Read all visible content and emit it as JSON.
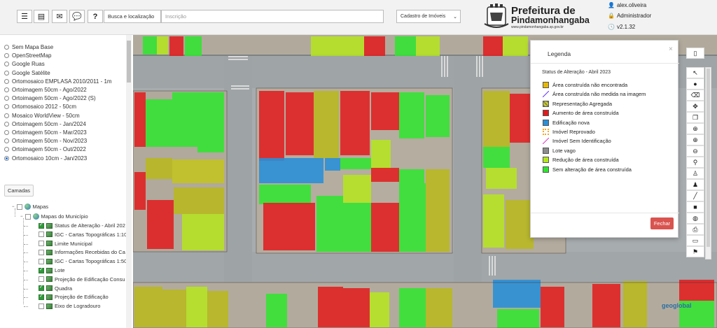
{
  "header": {
    "search_label": "Busca e localização",
    "search_placeholder": "Inscrição",
    "layer_select": "Cadastro de Imóveis",
    "brand_line1": "Prefeitura de",
    "brand_line2": "Pindamonhangaba",
    "brand_line3": "www.pindamonhangaba.sp.gov.br",
    "user": "alex.oliveira",
    "role": "Administrador",
    "version": "v2.1.32"
  },
  "basemaps": [
    {
      "label": "Sem Mapa Base",
      "selected": false
    },
    {
      "label": "OpenStreetMap",
      "selected": false
    },
    {
      "label": "Google Ruas",
      "selected": false
    },
    {
      "label": "Google Satélite",
      "selected": false
    },
    {
      "label": "Ortomosaico EMPLASA 2010/2011 - 1m",
      "selected": false
    },
    {
      "label": "Ortoimagem 50cm - Ago/2022",
      "selected": false
    },
    {
      "label": "Ortoimagem 50cm - Ago/2022 (S)",
      "selected": false
    },
    {
      "label": "Ortomosaico 2012 - 50cm",
      "selected": false
    },
    {
      "label": "Mosaico WorldView - 50cm",
      "selected": false
    },
    {
      "label": "Ortoimagem 50cm - Jan/2024",
      "selected": false
    },
    {
      "label": "Ortoimagem 50cm - Mar/2023",
      "selected": false
    },
    {
      "label": "Ortoimagem 50cm - Nov/2023",
      "selected": false
    },
    {
      "label": "Ortoimagem 50cm - Out/2022",
      "selected": false
    },
    {
      "label": "Ortomosaico 10cm - Jan/2023",
      "selected": true
    }
  ],
  "layers_button": "Camadas",
  "tree": {
    "root": "Mapas",
    "group": "Mapas do Município",
    "items": [
      {
        "label": "Status de Alteração - Abril 202",
        "checked": true
      },
      {
        "label": "IGC - Cartas Topográficas 1:10",
        "checked": false
      },
      {
        "label": "Limite Municipal",
        "checked": false
      },
      {
        "label": "Informações Recebidas do Ca",
        "checked": false
      },
      {
        "label": "IGC - Cartas Topográficas 1:50",
        "checked": false
      },
      {
        "label": "Lote",
        "checked": true
      },
      {
        "label": "Projeção de Edificação Consu",
        "checked": false
      },
      {
        "label": "Quadra",
        "checked": true
      },
      {
        "label": "Projeção de Edificação",
        "checked": true
      },
      {
        "label": "Eixo de Logradouro",
        "checked": false
      }
    ]
  },
  "legend": {
    "title": "Legenda",
    "subtitle": "Status de Alteração - Abril 2023",
    "close_label": "Fechar",
    "items": [
      {
        "label": "Área construída não encontrada",
        "color": "#e6b800"
      },
      {
        "label": "Área construída não medida na imagem",
        "color": "#6a3cf0"
      },
      {
        "label": "Representação Agregada",
        "color": "#8a8a2a"
      },
      {
        "label": "Aumento de área construída",
        "color": "#e31a1c"
      },
      {
        "label": "Edificação nova",
        "color": "#2b8fd6"
      },
      {
        "label": "Imóvel Reprovado",
        "color": "#f5a623"
      },
      {
        "label": "Imóvel Sem Identificação",
        "color": "#e040c0"
      },
      {
        "label": "Lote vago",
        "color": "#8c8c8c"
      },
      {
        "label": "Redução de área construída",
        "color": "#b5e61d"
      },
      {
        "label": "Sem alteração de área construída",
        "color": "#2ee62e"
      }
    ]
  },
  "watermark": "geoglobal"
}
